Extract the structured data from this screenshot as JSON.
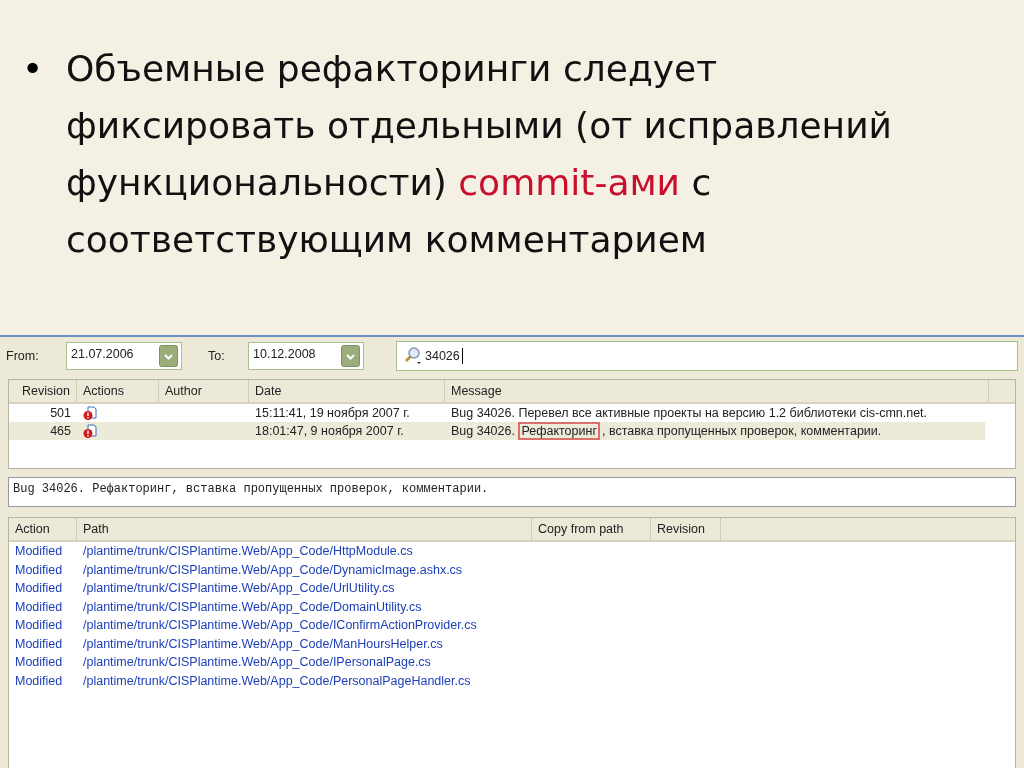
{
  "slide": {
    "bullet_symbol": "•",
    "bullet_segments": [
      {
        "text": "Объемные рефакторинги следует фиксировать отдельными (от исправлений функциональности) ",
        "accent": false
      },
      {
        "text": "commit-ами",
        "accent": true
      },
      {
        "text": " с соответствующим комментарием",
        "accent": false
      }
    ]
  },
  "filter": {
    "from_label": "From:",
    "from_value": "21.07.2006",
    "to_label": "To:",
    "to_value": "10.12.2008",
    "search_value": "34026"
  },
  "log": {
    "columns": [
      "Revision",
      "Actions",
      "Author",
      "Date",
      "Message"
    ],
    "rows": [
      {
        "revision": "501",
        "author": "",
        "date": "15:11:41, 19 ноября 2007 г.",
        "message": [
          {
            "text": "Bug 34026. ",
            "highlighted": false
          },
          {
            "text": "Перевел все активные проекты на версию 1.2 библиотеки cis-cmn.net.",
            "highlighted": false
          }
        ],
        "selected": false
      },
      {
        "revision": "465",
        "author": "",
        "date": "18:01:47, 9 ноября 2007 г.",
        "message": [
          {
            "text": "Bug 34026. ",
            "highlighted": false
          },
          {
            "text": "Рефакторинг",
            "highlighted": true
          },
          {
            "text": ", вставка пропущенных проверок, комментарии.",
            "highlighted": false
          }
        ],
        "selected": true
      }
    ]
  },
  "message_box": {
    "value": "Bug 34026. Рефакторинг, вставка пропущенных проверок, комментарии."
  },
  "paths": {
    "columns": [
      "Action",
      "Path",
      "Copy from path",
      "Revision"
    ],
    "rows": [
      {
        "action": "Modified",
        "path": "/plantime/trunk/CISPlantime.Web/App_Code/HttpModule.cs"
      },
      {
        "action": "Modified",
        "path": "/plantime/trunk/CISPlantime.Web/App_Code/DynamicImage.ashx.cs"
      },
      {
        "action": "Modified",
        "path": "/plantime/trunk/CISPlantime.Web/App_Code/UrlUtility.cs"
      },
      {
        "action": "Modified",
        "path": "/plantime/trunk/CISPlantime.Web/App_Code/DomainUtility.cs"
      },
      {
        "action": "Modified",
        "path": "/plantime/trunk/CISPlantime.Web/App_Code/IConfirmActionProvider.cs"
      },
      {
        "action": "Modified",
        "path": "/plantime/trunk/CISPlantime.Web/App_Code/ManHoursHelper.cs"
      },
      {
        "action": "Modified",
        "path": "/plantime/trunk/CISPlantime.Web/App_Code/IPersonalPage.cs"
      },
      {
        "action": "Modified",
        "path": "/plantime/trunk/CISPlantime.Web/App_Code/PersonalPageHandler.cs"
      }
    ]
  }
}
